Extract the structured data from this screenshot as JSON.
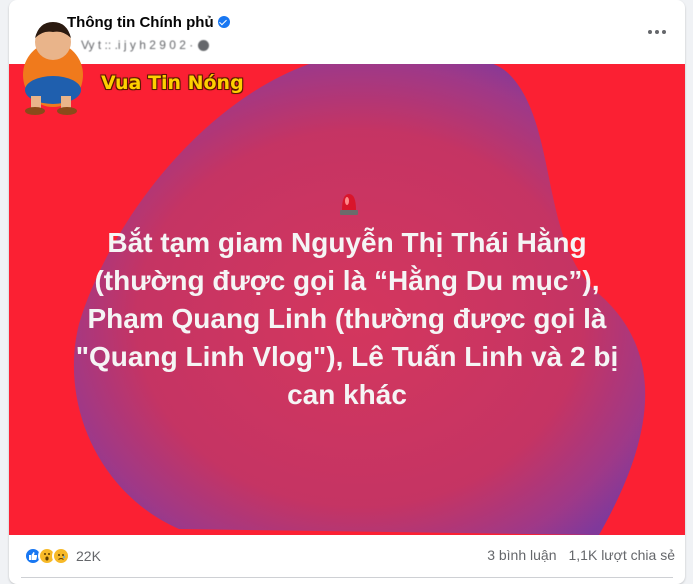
{
  "post": {
    "page_name": "Thông tin Chính phủ",
    "meta_text": "Vy t :: .i j   y h 2 9 0 2 ·",
    "brand_text": "Vua Tin Nóng",
    "headline": "Bắt tạm giam Nguyễn Thị Thái Hằng (thường được gọi là “Hằng Du mục”), Phạm Quang Linh (thường được gọi là \"Quang Linh Vlog\"), Lê Tuấn Linh và 2 bị can khác",
    "colors": {
      "background": "#fb2033",
      "blob": "#7a3aa0",
      "brand": "#ffd000"
    }
  },
  "footer": {
    "reaction_count": "22K",
    "comments": "3 bình luận",
    "shares": "1,1K lượt chia sẻ",
    "reaction_icons": [
      "like-icon",
      "wow-icon",
      "sad-icon"
    ]
  }
}
